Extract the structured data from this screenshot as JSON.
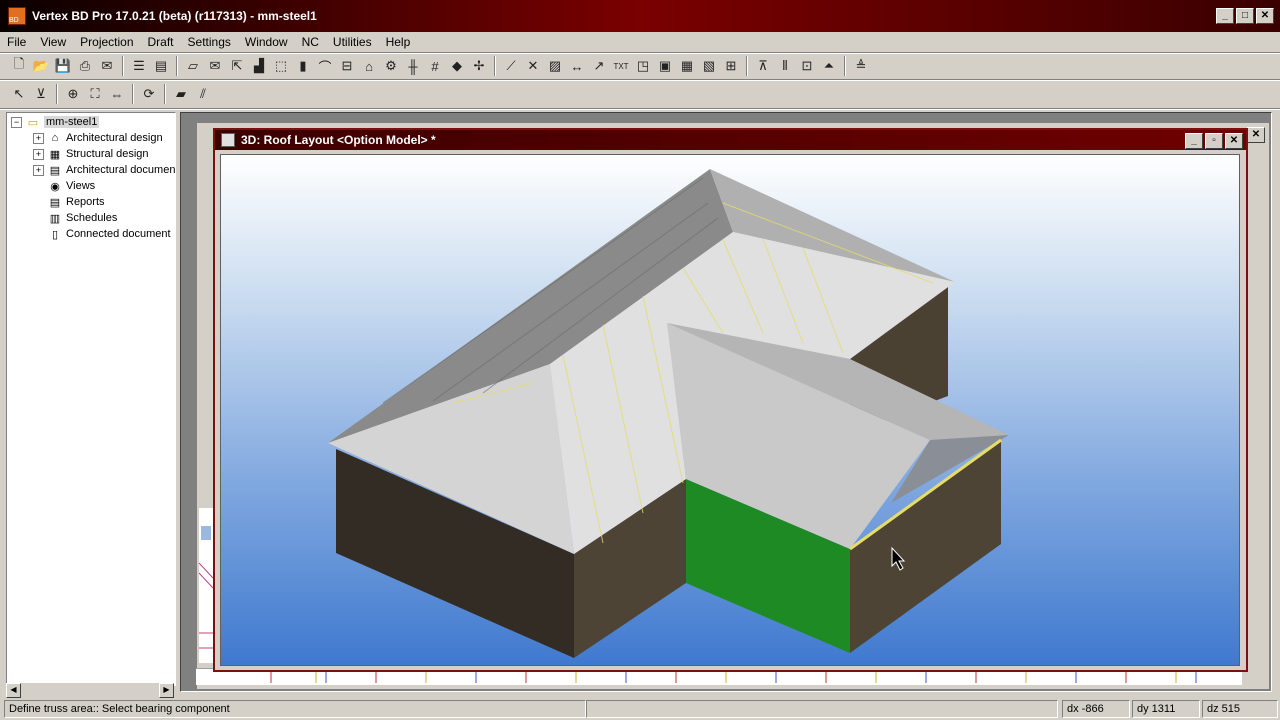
{
  "app": {
    "title": "Vertex BD Pro 17.0.21 (beta) (r117313) - mm-steel1",
    "icon_text": "BD"
  },
  "menu": [
    "File",
    "View",
    "Projection",
    "Draft",
    "Settings",
    "Window",
    "NC",
    "Utilities",
    "Help"
  ],
  "tree": {
    "root": "mm-steel1",
    "items": [
      {
        "label": "Architectural design",
        "icon": "architectural-design-icon",
        "glyph": "⌂",
        "expandable": true
      },
      {
        "label": "Structural design",
        "icon": "structural-design-icon",
        "glyph": "▦",
        "expandable": true
      },
      {
        "label": "Architectural documen",
        "icon": "drawing-document-icon",
        "glyph": "▤",
        "expandable": true
      },
      {
        "label": "Views",
        "icon": "views-icon",
        "glyph": "◉",
        "expandable": false
      },
      {
        "label": "Reports",
        "icon": "reports-icon",
        "glyph": "▤",
        "expandable": false
      },
      {
        "label": "Schedules",
        "icon": "schedules-icon",
        "glyph": "▥",
        "expandable": false
      },
      {
        "label": "Connected document",
        "icon": "document-icon",
        "glyph": "▯",
        "expandable": false
      }
    ]
  },
  "document_window": {
    "title": "3D: Roof Layout <Option Model> *"
  },
  "status": {
    "message": "Define truss area:: Select bearing component",
    "dx": "dx -866",
    "dy": "dy 1311",
    "dz": "dz 515"
  },
  "colors": {
    "titlebar": "#7a0000",
    "wall": "#4a4133",
    "roof": "#d8d8d8",
    "selected_wall": "#1d8a24",
    "truss_line": "#e6dc6a"
  },
  "toolbar1_icons": [
    {
      "name": "new-file-icon",
      "glyph": "🗋"
    },
    {
      "name": "open-folder-icon",
      "glyph": "📂"
    },
    {
      "name": "save-icon",
      "glyph": "💾"
    },
    {
      "name": "print-icon",
      "glyph": "⎙"
    },
    {
      "name": "send-icon",
      "glyph": "✉"
    },
    {
      "name": "sep"
    },
    {
      "name": "layers-icon",
      "glyph": "☰"
    },
    {
      "name": "stack-icon",
      "glyph": "▤"
    },
    {
      "name": "sep"
    },
    {
      "name": "eraser-icon",
      "glyph": "▱"
    },
    {
      "name": "envelope-icon",
      "glyph": "✉"
    },
    {
      "name": "arrow-icon",
      "glyph": "⇱"
    },
    {
      "name": "stairs-icon",
      "glyph": "▟"
    },
    {
      "name": "select-box-icon",
      "glyph": "⬚"
    },
    {
      "name": "wall-icon",
      "glyph": "▮"
    },
    {
      "name": "arc-icon",
      "glyph": "⌒"
    },
    {
      "name": "window-icon",
      "glyph": "⊟"
    },
    {
      "name": "roof-icon",
      "glyph": "⌂"
    },
    {
      "name": "settings-icon",
      "glyph": "⚙"
    },
    {
      "name": "column-icon",
      "glyph": "╫"
    },
    {
      "name": "grid-icon",
      "glyph": "#"
    },
    {
      "name": "terrain-icon",
      "glyph": "◆"
    },
    {
      "name": "snap-icon",
      "glyph": "✢"
    },
    {
      "name": "sep"
    },
    {
      "name": "line-icon",
      "glyph": "⟋"
    },
    {
      "name": "cross-line-icon",
      "glyph": "✕"
    },
    {
      "name": "hatch-icon",
      "glyph": "▨"
    },
    {
      "name": "dimension-icon",
      "glyph": "↔"
    },
    {
      "name": "leader-icon",
      "glyph": "↗"
    },
    {
      "name": "text-icon",
      "glyph": "TXT"
    },
    {
      "name": "symbol-icon",
      "glyph": "◳"
    },
    {
      "name": "image-icon",
      "glyph": "▣"
    },
    {
      "name": "table-icon",
      "glyph": "▦"
    },
    {
      "name": "block-icon",
      "glyph": "▧"
    },
    {
      "name": "layout-icon",
      "glyph": "⊞"
    },
    {
      "name": "sep"
    },
    {
      "name": "truss-icon",
      "glyph": "⊼"
    },
    {
      "name": "columns-icon",
      "glyph": "⦀"
    },
    {
      "name": "panel-icon",
      "glyph": "⊡"
    },
    {
      "name": "roof-truss-icon",
      "glyph": "⏶"
    },
    {
      "name": "sep"
    },
    {
      "name": "level-icon",
      "glyph": "≜"
    }
  ],
  "toolbar2_icons": [
    {
      "name": "pointer-icon",
      "glyph": "↖"
    },
    {
      "name": "filter-select-icon",
      "glyph": "⊻"
    },
    {
      "name": "sep"
    },
    {
      "name": "zoom-icon",
      "glyph": "⊕"
    },
    {
      "name": "zoom-extents-icon",
      "glyph": "⛶"
    },
    {
      "name": "zoom-window-icon",
      "glyph": "⇔"
    },
    {
      "name": "sep"
    },
    {
      "name": "refresh-icon",
      "glyph": "⟳"
    },
    {
      "name": "sep"
    },
    {
      "name": "shade-icon",
      "glyph": "▰"
    },
    {
      "name": "section-icon",
      "glyph": "⫽"
    }
  ]
}
